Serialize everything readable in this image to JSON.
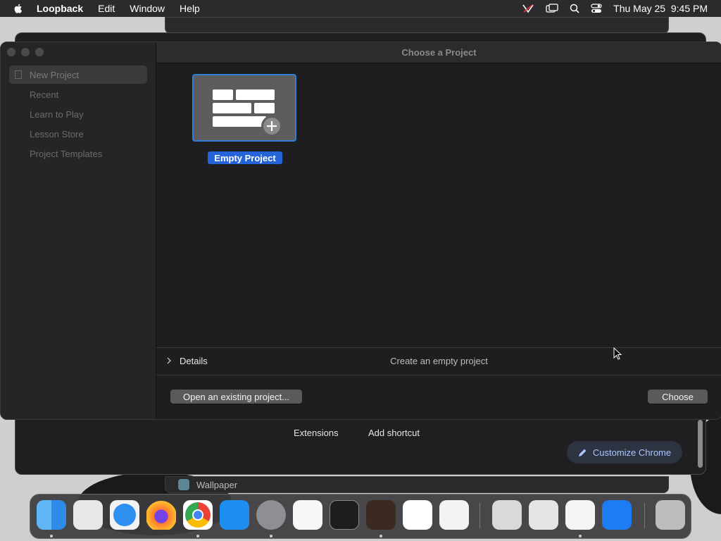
{
  "menubar": {
    "app_name": "Loopback",
    "menus": [
      "Edit",
      "Window",
      "Help"
    ],
    "clock": "Thu May 25  9:45 PM",
    "status_icons": [
      "loopback-icon",
      "screen-mirror-icon",
      "search-icon",
      "control-center-icon"
    ]
  },
  "dialog": {
    "title": "Choose a Project",
    "sidebar": {
      "items": [
        {
          "label": "New Project",
          "selected": true
        },
        {
          "label": "Recent"
        },
        {
          "label": "Learn to Play"
        },
        {
          "label": "Lesson Store"
        },
        {
          "label": "Project Templates"
        }
      ]
    },
    "template": {
      "label": "Empty Project"
    },
    "details": {
      "label": "Details",
      "description": "Create an empty project"
    },
    "buttons": {
      "open_existing": "Open an existing project...",
      "choose": "Choose"
    }
  },
  "background_chrome": {
    "links": [
      "Extensions",
      "Add shortcut"
    ],
    "customize_label": "Customize Chrome",
    "wallpaper_label": "Wallpaper"
  },
  "dock": {
    "apps": [
      "Finder",
      "Launchpad",
      "Safari",
      "Firefox",
      "Google Chrome",
      "App Store",
      "System Settings",
      "TextEdit",
      "Terminal",
      "GarageBand",
      "Visual Studio Code",
      "Visual Studio",
      "Boot Camp Assistant",
      "Disk Utility",
      "Loopback",
      "Xcode",
      "Trash"
    ]
  },
  "colors": {
    "accent": "#2563d9",
    "dialog_bg": "#1e1e20",
    "sidebar_bg": "#252527"
  }
}
